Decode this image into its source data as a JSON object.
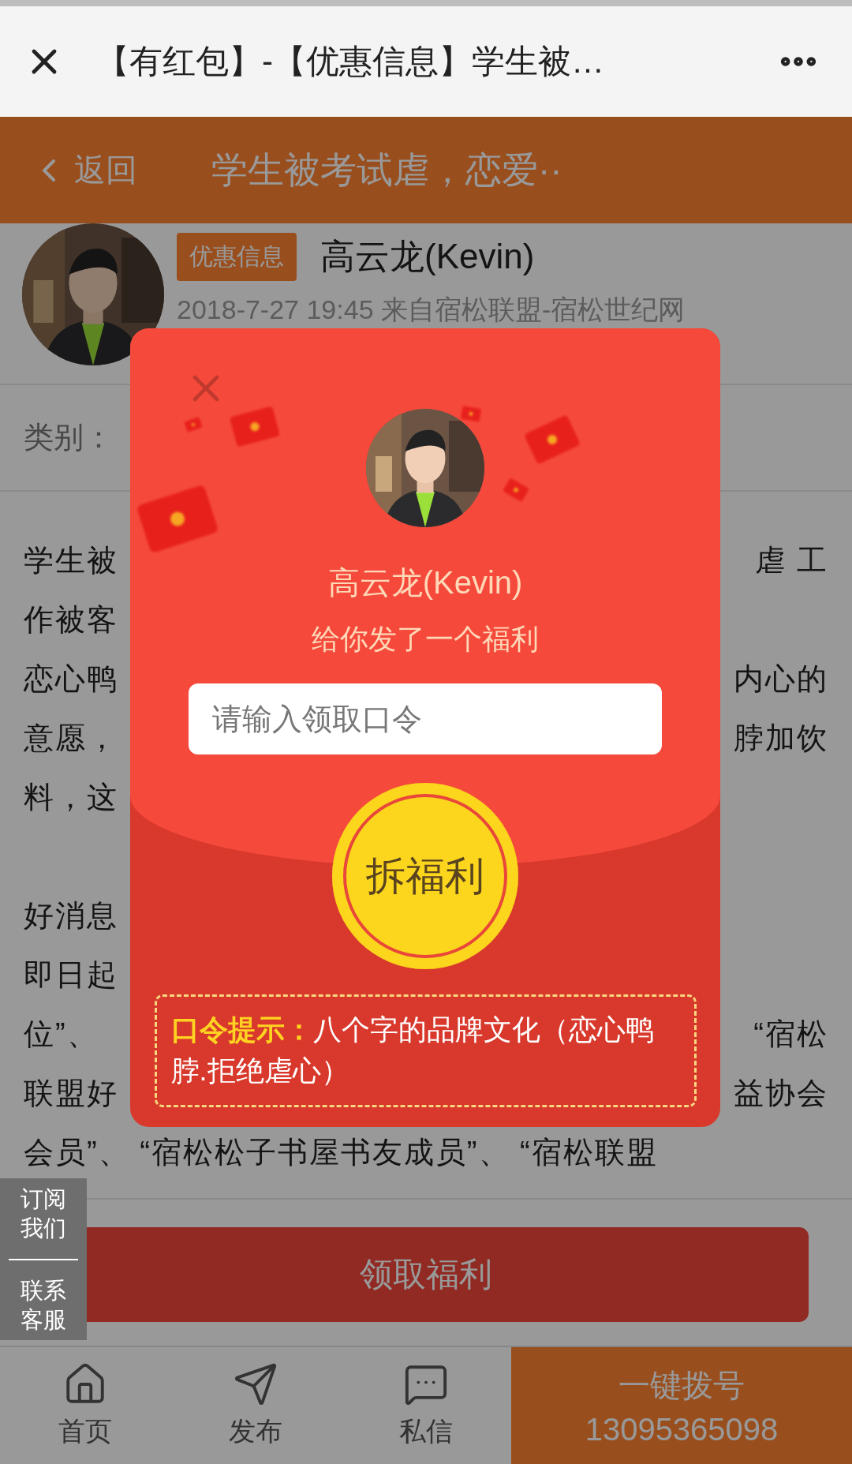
{
  "nav": {
    "title": "【有红包】-【优惠信息】学生被…"
  },
  "header": {
    "back": "返回",
    "title": "学生被考试虐，恋爱··"
  },
  "post": {
    "tag": "优惠信息",
    "author": "高云龙(Kevin)",
    "meta": "2018-7-27 19:45  来自宿松联盟-宿松世纪网",
    "category_label": "类别："
  },
  "article": {
    "paragraphs": [
      {
        "lines": [
          {
            "left": "学生被",
            "right": "虐 工"
          },
          {
            "left": "作被客"
          },
          {
            "left": "恋心鸭",
            "right": "内心的"
          },
          {
            "left": "意愿，",
            "right": "脖加饮"
          },
          {
            "left": "料，这"
          }
        ]
      },
      {
        "lines": [
          {
            "left": "好消息"
          },
          {
            "left": "即日起"
          },
          {
            "left": "位”、",
            "right": "“宿松"
          },
          {
            "left": "联盟好",
            "right": "益协会"
          },
          {
            "left": "会员”、 “宿松松子书屋书友成员”、 “宿松联盟"
          }
        ]
      }
    ]
  },
  "claim_button": "领取福利",
  "side_tab": {
    "subscribe": [
      "订阅",
      "我们"
    ],
    "contact": [
      "联系",
      "客服"
    ]
  },
  "tab_bar": {
    "items": [
      {
        "label": "首页",
        "kind": "home"
      },
      {
        "label": "发布",
        "kind": "send"
      },
      {
        "label": "私信",
        "kind": "message"
      }
    ],
    "call": {
      "label": "一键拨号",
      "phone": "13095365098"
    }
  },
  "modal": {
    "sender": "高云龙(Kevin)",
    "message": "给你发了一个福利",
    "password_field": {
      "placeholder": "请输入领取口令"
    },
    "open_button": "拆福利",
    "hint": "**口令提示：**八个字的品牌文化（恋心鸭脖.拒绝虐心）"
  }
}
